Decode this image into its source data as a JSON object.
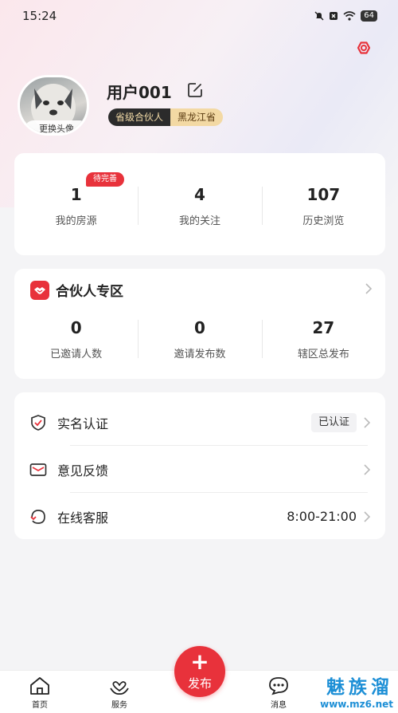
{
  "status_bar": {
    "time": "15:24",
    "battery": "64"
  },
  "profile": {
    "avatar_caption": "更换头像",
    "username": "用户001",
    "role_badge": "省级合伙人",
    "region_badge": "黑龙江省"
  },
  "stats": {
    "pending_tag": "待完善",
    "items": [
      {
        "value": "1",
        "label": "我的房源"
      },
      {
        "value": "4",
        "label": "我的关注"
      },
      {
        "value": "107",
        "label": "历史浏览"
      }
    ]
  },
  "partner": {
    "title": "合伙人专区",
    "items": [
      {
        "value": "0",
        "label": "已邀请人数"
      },
      {
        "value": "0",
        "label": "邀请发布数"
      },
      {
        "value": "27",
        "label": "辖区总发布"
      }
    ]
  },
  "menu": {
    "realname": {
      "label": "实名认证",
      "badge": "已认证"
    },
    "feedback": {
      "label": "意见反馈"
    },
    "service": {
      "label": "在线客服",
      "value": "8:00-21:00"
    }
  },
  "tabbar": {
    "home": "首页",
    "services": "服务",
    "publish": "发布",
    "messages": "消息"
  },
  "watermark": {
    "title": "魅族溜",
    "url": "www.mz6.net"
  },
  "colors": {
    "accent": "#e8323b",
    "watermark": "#1d8fd6",
    "badge_dark": "#2b2b2b",
    "badge_gold": "#f3d9a4"
  },
  "icons": [
    "settings-icon",
    "edit-icon",
    "handshake-icon",
    "shield-check-icon",
    "mail-icon",
    "headset-icon",
    "chevron-right-icon",
    "home-icon",
    "heart-hands-icon",
    "plus-icon",
    "chat-icon"
  ]
}
